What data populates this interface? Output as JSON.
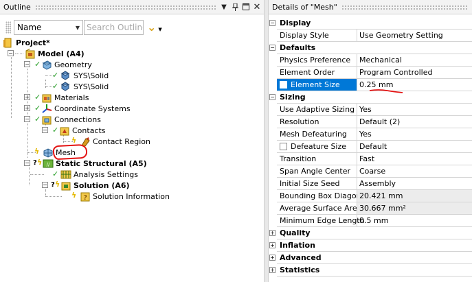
{
  "outline": {
    "title": "Outline",
    "header_buttons": [
      "dropdown-icon",
      "pin-icon",
      "maximize-icon",
      "close-icon"
    ],
    "filter_combo": {
      "value": "Name"
    },
    "search": {
      "placeholder": "Search Outline"
    },
    "tree": {
      "project": "Project*",
      "model": "Model (A4)",
      "geometry": "Geometry",
      "solid1": "SYS\\Solid",
      "solid2": "SYS\\Solid",
      "materials": "Materials",
      "coordinate_systems": "Coordinate Systems",
      "connections": "Connections",
      "contacts": "Contacts",
      "contact_region": "Contact Region",
      "mesh": "Mesh",
      "static_structural": "Static Structural (A5)",
      "analysis_settings": "Analysis Settings",
      "solution": "Solution (A6)",
      "solution_information": "Solution Information"
    }
  },
  "details": {
    "title": "Details of \"Mesh\"",
    "categories": {
      "display": "Display",
      "defaults": "Defaults",
      "sizing": "Sizing",
      "quality": "Quality",
      "inflation": "Inflation",
      "advanced": "Advanced",
      "statistics": "Statistics"
    },
    "rows": {
      "display_style": {
        "key": "Display Style",
        "value": "Use Geometry Setting"
      },
      "physics_preference": {
        "key": "Physics Preference",
        "value": "Mechanical"
      },
      "element_order": {
        "key": "Element Order",
        "value": "Program Controlled"
      },
      "element_size": {
        "key": "Element Size",
        "value": "0.25 mm"
      },
      "use_adaptive_sizing": {
        "key": "Use Adaptive Sizing",
        "value": "Yes"
      },
      "resolution": {
        "key": "Resolution",
        "value": "Default (2)"
      },
      "mesh_defeaturing": {
        "key": "Mesh Defeaturing",
        "value": "Yes"
      },
      "defeature_size": {
        "key": "Defeature Size",
        "value": "Default"
      },
      "transition": {
        "key": "Transition",
        "value": "Fast"
      },
      "span_angle_center": {
        "key": "Span Angle Center",
        "value": "Coarse"
      },
      "initial_size_seed": {
        "key": "Initial Size Seed",
        "value": "Assembly"
      },
      "bounding_box_diagonal": {
        "key": "Bounding Box Diagonal",
        "value": "20.421 mm"
      },
      "average_surface_area": {
        "key": "Average Surface Area",
        "value": "30.667 mm²"
      },
      "minimum_edge_length": {
        "key": "Minimum Edge Length",
        "value": "0.5 mm"
      }
    }
  },
  "colors": {
    "selection": "#0078d7",
    "annotation": "#e41212",
    "check": "#1e9a1e",
    "pending": "#e3b800"
  }
}
